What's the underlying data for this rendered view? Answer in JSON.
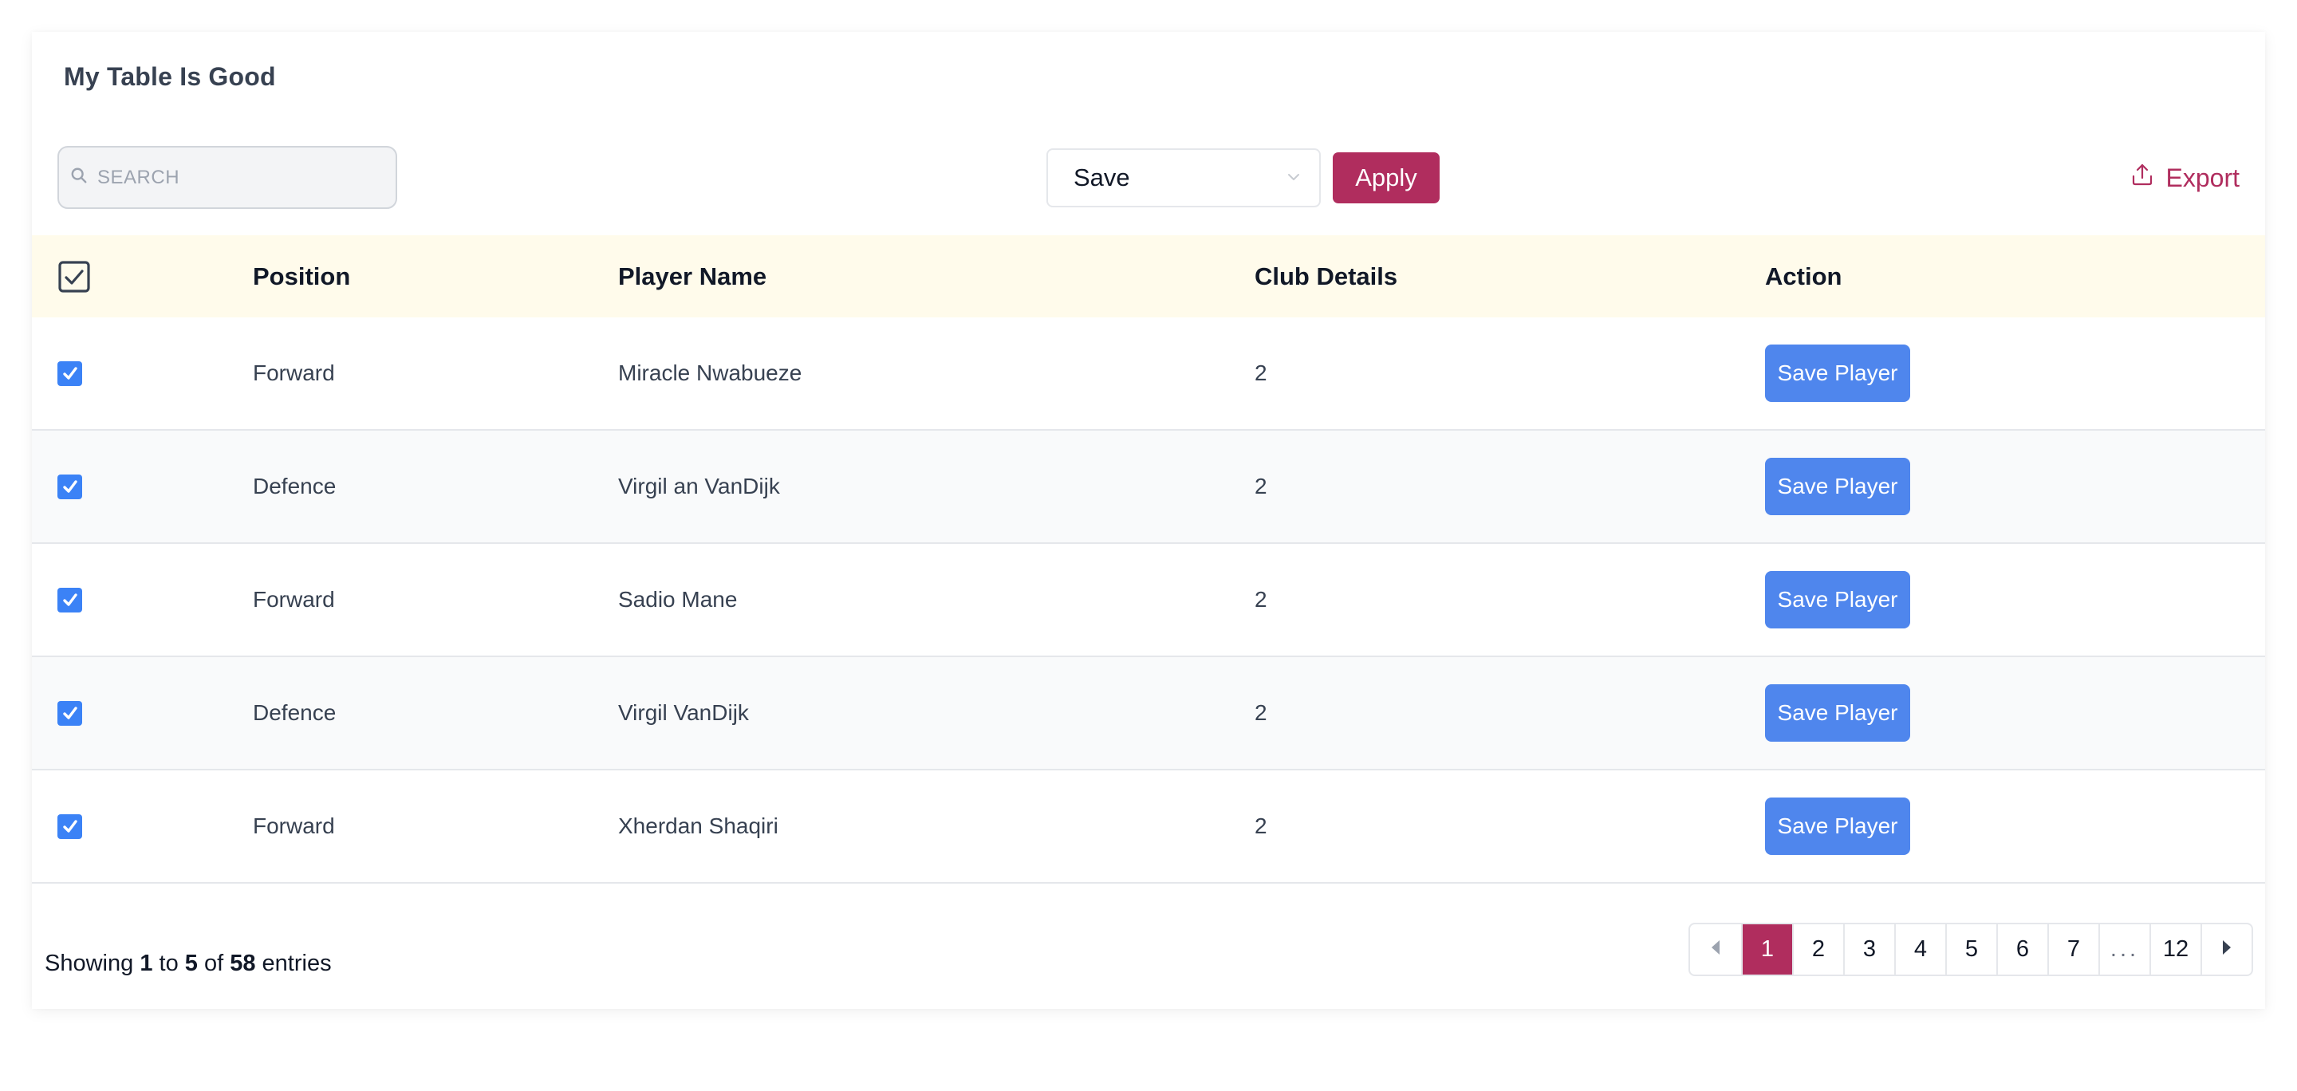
{
  "title": "My Table Is Good",
  "toolbar": {
    "search_placeholder": "SEARCH",
    "search_value": "",
    "bulk_action_selected": "Save",
    "apply_label": "Apply",
    "export_label": "Export"
  },
  "colors": {
    "accent": "#b02d5e",
    "primary_button": "#4f86ed",
    "checkbox": "#3b82f6",
    "header_bg": "#fffbeb",
    "alt_row_bg": "#f9fafb"
  },
  "table": {
    "header_checkbox_checked": true,
    "columns": [
      "Position",
      "Player Name",
      "Club Details",
      "Action"
    ],
    "rows": [
      {
        "checked": true,
        "position": "Forward",
        "player_name": "Miracle Nwabueze",
        "club_details": "2",
        "action_label": "Save Player"
      },
      {
        "checked": true,
        "position": "Defence",
        "player_name": "Virgil an VanDijk",
        "club_details": "2",
        "action_label": "Save Player"
      },
      {
        "checked": true,
        "position": "Forward",
        "player_name": "Sadio Mane",
        "club_details": "2",
        "action_label": "Save Player"
      },
      {
        "checked": true,
        "position": "Defence",
        "player_name": "Virgil VanDijk",
        "club_details": "2",
        "action_label": "Save Player"
      },
      {
        "checked": true,
        "position": "Forward",
        "player_name": "Xherdan Shaqiri",
        "club_details": "2",
        "action_label": "Save Player"
      }
    ]
  },
  "footer": {
    "showing_prefix": "Showing",
    "from": "1",
    "to_word": "to",
    "to": "5",
    "of_word": "of",
    "total": "58",
    "suffix": "entries"
  },
  "pagination": {
    "current_page": "1",
    "pages": [
      "1",
      "2",
      "3",
      "4",
      "5",
      "6",
      "7",
      "...",
      "12"
    ],
    "prev_icon": "caret-left-icon",
    "next_icon": "caret-right-icon"
  }
}
